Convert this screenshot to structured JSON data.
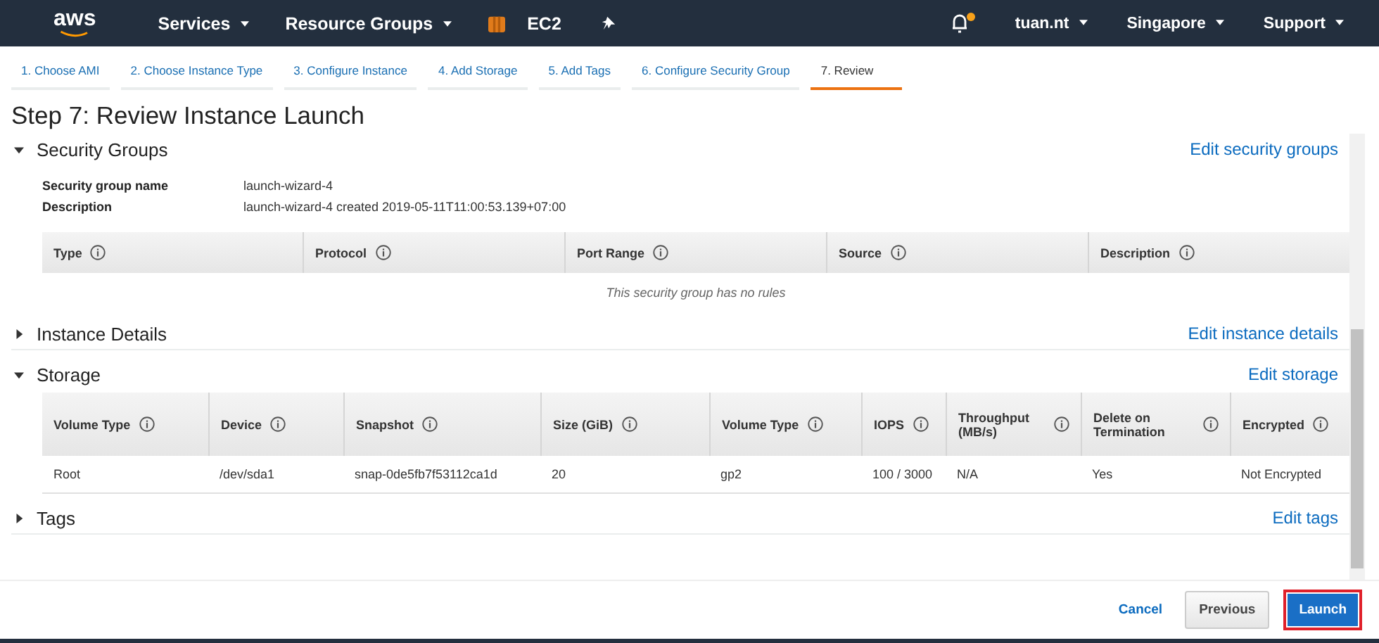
{
  "nav": {
    "logo": "aws",
    "menus": [
      {
        "label": "Services",
        "dropdown": true
      },
      {
        "label": "Resource Groups",
        "dropdown": true
      },
      {
        "label": "EC2",
        "dropdown": false
      }
    ],
    "notification_dot": true,
    "right_menus": [
      {
        "label": "tuan.nt"
      },
      {
        "label": "Singapore"
      },
      {
        "label": "Support"
      }
    ]
  },
  "steps": [
    {
      "label": "1. Choose AMI",
      "selected": false
    },
    {
      "label": "2. Choose Instance Type",
      "selected": false
    },
    {
      "label": "3. Configure Instance",
      "selected": false
    },
    {
      "label": "4. Add Storage",
      "selected": false
    },
    {
      "label": "5. Add Tags",
      "selected": false
    },
    {
      "label": "6. Configure Security Group",
      "selected": false
    },
    {
      "label": "7. Review",
      "selected": true
    }
  ],
  "title": "Step 7: Review Instance Launch",
  "security_groups": {
    "title": "Security Groups",
    "expanded": true,
    "edit_link": "Edit security groups",
    "fields": [
      {
        "label": "Security group name",
        "value": "launch-wizard-4"
      },
      {
        "label": "Description",
        "value": "launch-wizard-4 created 2019-05-11T11:00:53.139+07:00"
      }
    ],
    "columns": [
      "Type",
      "Protocol",
      "Port Range",
      "Source",
      "Description"
    ],
    "empty_message": "This security group has no rules"
  },
  "instance_details": {
    "title": "Instance Details",
    "expanded": false,
    "edit_link": "Edit instance details"
  },
  "storage": {
    "title": "Storage",
    "expanded": true,
    "edit_link": "Edit storage",
    "columns": [
      "Volume Type",
      "Device",
      "Snapshot",
      "Size (GiB)",
      "Volume Type",
      "IOPS",
      "Throughput (MB/s)",
      "Delete on Termination",
      "Encrypted"
    ],
    "rows": [
      [
        "Root",
        "/dev/sda1",
        "snap-0de5fb7f53112ca1d",
        "20",
        "gp2",
        "100 / 3000",
        "N/A",
        "Yes",
        "Not Encrypted"
      ]
    ]
  },
  "tags": {
    "title": "Tags",
    "expanded": false,
    "edit_link": "Edit tags"
  },
  "footer": {
    "cancel": "Cancel",
    "previous": "Previous",
    "launch": "Launch"
  }
}
